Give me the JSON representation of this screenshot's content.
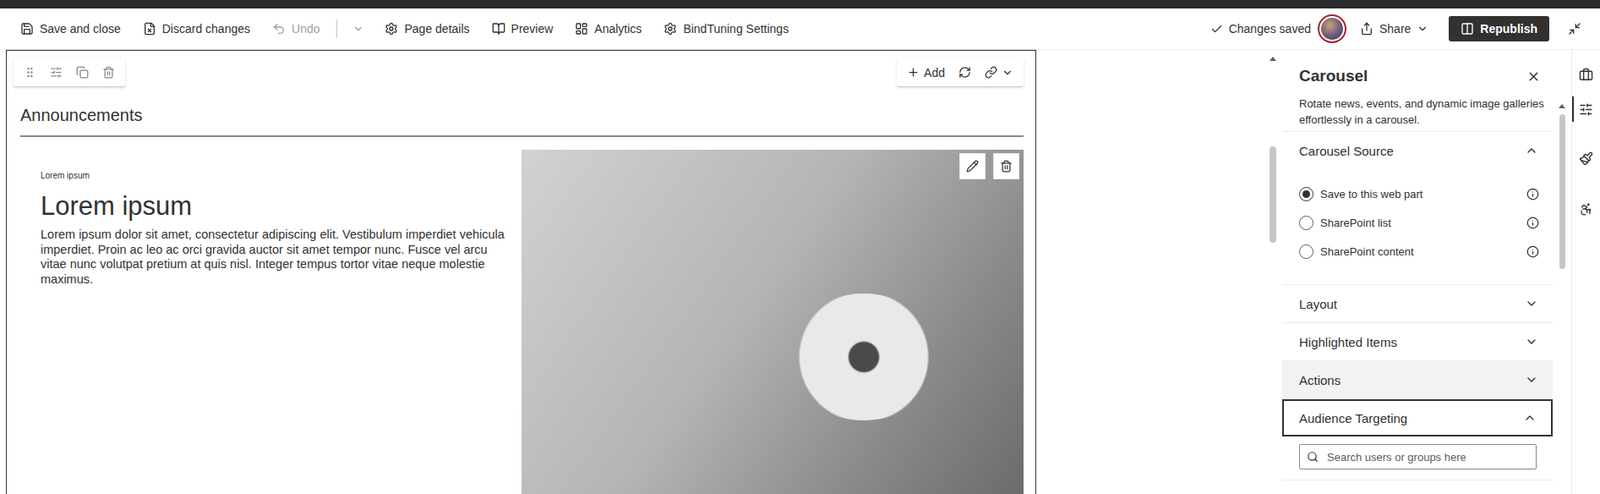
{
  "command_bar": {
    "items": [
      {
        "label": "Save and close",
        "disabled": false,
        "has_menu": false
      },
      {
        "label": "Discard changes",
        "disabled": false,
        "has_menu": false
      },
      {
        "label": "Undo",
        "disabled": true,
        "has_menu": true
      },
      {
        "label": "Page details",
        "disabled": false,
        "has_menu": false
      },
      {
        "label": "Preview",
        "disabled": false,
        "has_menu": false
      },
      {
        "label": "Analytics",
        "disabled": false,
        "has_menu": false
      },
      {
        "label": "BindTuning Settings",
        "disabled": false,
        "has_menu": false
      }
    ],
    "status": "Changes saved",
    "share": "Share",
    "publish": "Republish"
  },
  "web_part": {
    "add": "Add",
    "title": "Announcements",
    "slide": {
      "eyebrow": "Lorem ipsum",
      "heading": "Lorem ipsum",
      "body": "Lorem ipsum dolor sit amet, consectetur adipiscing elit. Vestibulum imperdiet vehicula imperdiet. Proin ac leo ac orci gravida auctor sit amet tempor nunc. Fusce vel arcu vitae nunc volutpat pretium at quis nisl. Integer tempus tortor vitae neque molestie maximus."
    }
  },
  "property_pane": {
    "title": "Carousel",
    "description": "Rotate news, events, and dynamic image galleries effortlessly in a carousel.",
    "sections": [
      {
        "label": "Carousel Source",
        "kind": "radios",
        "expanded": true,
        "highlighted": false,
        "focused": false,
        "options": [
          {
            "label": "Save to this web part",
            "selected": true
          },
          {
            "label": "SharePoint list",
            "selected": false
          },
          {
            "label": "SharePoint content",
            "selected": false
          }
        ]
      },
      {
        "label": "Layout",
        "kind": "plain",
        "expanded": false,
        "highlighted": false,
        "focused": false
      },
      {
        "label": "Highlighted Items",
        "kind": "plain",
        "expanded": false,
        "highlighted": false,
        "focused": false
      },
      {
        "label": "Actions",
        "kind": "plain",
        "expanded": false,
        "highlighted": true,
        "focused": false
      },
      {
        "label": "Audience Targeting",
        "kind": "search",
        "expanded": true,
        "highlighted": false,
        "focused": true,
        "placeholder": "Search users or groups here"
      }
    ]
  },
  "rail": [
    {
      "selected": false
    },
    {
      "selected": true
    },
    {
      "selected": false
    },
    {
      "selected": false
    }
  ]
}
